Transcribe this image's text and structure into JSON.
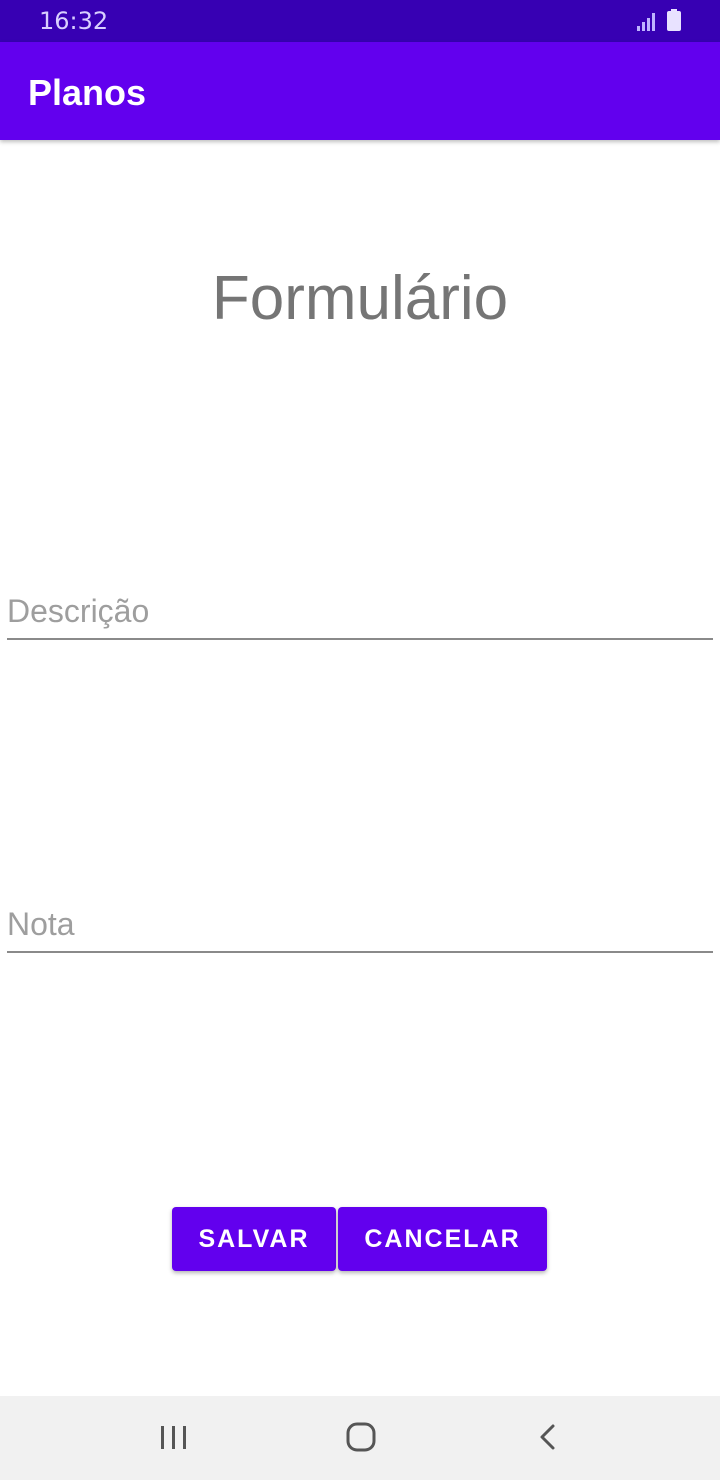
{
  "status_bar": {
    "time": "16:32",
    "icons": [
      "signal-icon",
      "battery-icon"
    ]
  },
  "app_bar": {
    "title": "Planos"
  },
  "form": {
    "title": "Formulário",
    "description_field": {
      "value": "",
      "placeholder": "Descrição"
    },
    "grade_field": {
      "value": "",
      "placeholder": "Nota"
    },
    "save_label": "SALVAR",
    "cancel_label": "CANCELAR"
  },
  "nav_bar": {
    "icons": [
      "recent-apps-icon",
      "home-icon",
      "back-icon"
    ]
  },
  "colors": {
    "primary": "#6200ee",
    "primary_dark": "#3700b3",
    "title_text": "#757575",
    "hint_text": "#9e9e9e",
    "nav_background": "#f1f1f1"
  }
}
